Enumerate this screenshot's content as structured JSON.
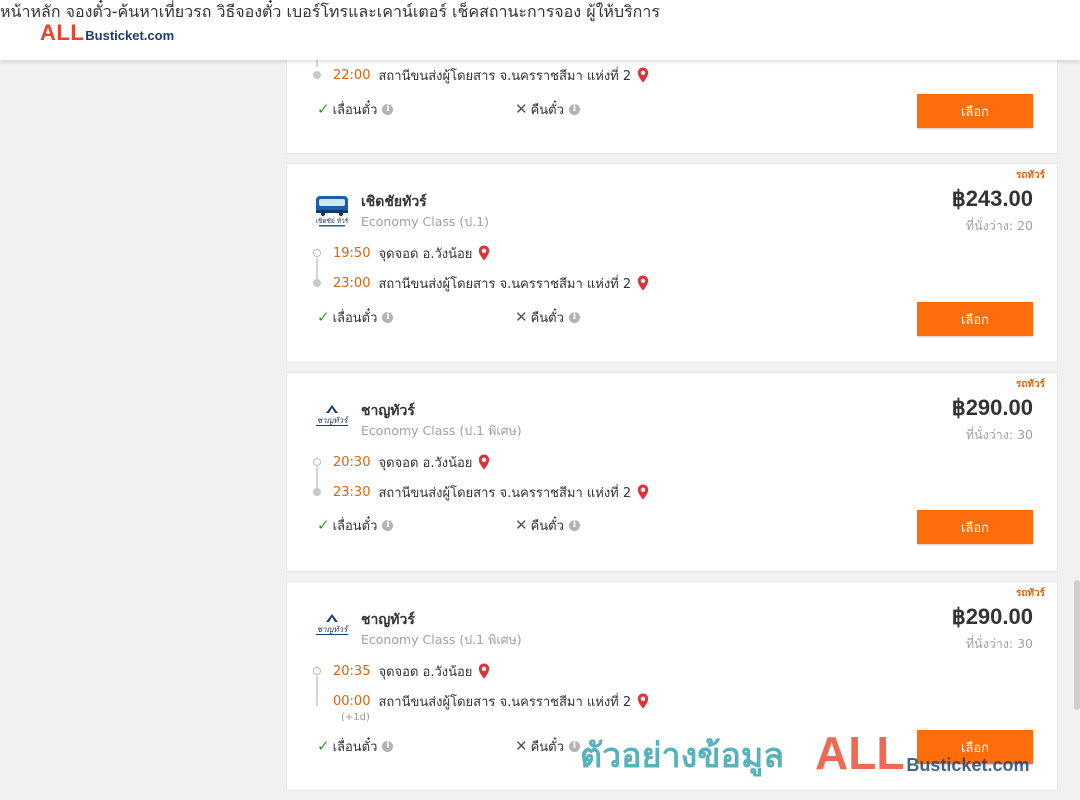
{
  "header": {
    "logo_all": "ALL",
    "logo_rest": "Busticket.com",
    "nav": [
      "หน้าหลัก",
      "จองตั๋ว-ค้นหาเที่ยวรถ",
      "วิธีจองตั๋ว",
      "เบอร์โทรและเคาน์เตอร์",
      "เช็คสถานะการจอง",
      "ผู้ให้บริการ"
    ]
  },
  "partial_card": {
    "arrive_time": "22:00",
    "arrive_place": "สถานีขนส่งผู้โดยสาร จ.นครราชสีมา แห่งที่ 2",
    "reschedule": "เลื่อนตั๋ว",
    "refund": "คืนตั๋ว",
    "select": "เลือก"
  },
  "trips": [
    {
      "tag": "รถทัวร์",
      "operator": "เชิดชัยทัวร์",
      "bus_class": "Economy Class (ป.1)",
      "price": "฿243.00",
      "seats": "ที่นั่งว่าง: 20",
      "depart_time": "19:50",
      "depart_place": "จุดจอด อ.วังน้อย",
      "arrive_time": "23:00",
      "arrive_place": "สถานีขนส่งผู้โดยสาร จ.นครราชสีมา แห่งที่ 2",
      "next_day": "",
      "reschedule": "เลื่อนตั๋ว",
      "refund": "คืนตั๋ว",
      "select": "เลือก",
      "logo_caption": "เชิดชัย ทัวร์"
    },
    {
      "tag": "รถทัวร์",
      "operator": "ชาญทัวร์",
      "bus_class": "Economy Class (ป.1 พิเศษ)",
      "price": "฿290.00",
      "seats": "ที่นั่งว่าง: 30",
      "depart_time": "20:30",
      "depart_place": "จุดจอด อ.วังน้อย",
      "arrive_time": "23:30",
      "arrive_place": "สถานีขนส่งผู้โดยสาร จ.นครราชสีมา แห่งที่ 2",
      "next_day": "",
      "reschedule": "เลื่อนตั๋ว",
      "refund": "คืนตั๋ว",
      "select": "เลือก",
      "logo_caption": "ชาญทัวร์"
    },
    {
      "tag": "รถทัวร์",
      "operator": "ชาญทัวร์",
      "bus_class": "Economy Class (ป.1 พิเศษ)",
      "price": "฿290.00",
      "seats": "ที่นั่งว่าง: 30",
      "depart_time": "20:35",
      "depart_place": "จุดจอด อ.วังน้อย",
      "arrive_time": "00:00",
      "arrive_place": "สถานีขนส่งผู้โดยสาร จ.นครราชสีมา แห่งที่ 2",
      "next_day": "(+1d)",
      "reschedule": "เลื่อนตั๋ว",
      "refund": "คืนตั๋ว",
      "select": "เลือก",
      "logo_caption": "ชาญทัวร์"
    }
  ],
  "icons": {
    "location": "map-pin-icon",
    "check": "check-icon",
    "cross": "x-icon",
    "info": "info-icon"
  },
  "colors": {
    "accent": "#fe6d0b",
    "time": "#e0620c",
    "check": "#2a9d3a",
    "pin": "#e0323a"
  },
  "watermark": {
    "text": "ตัวอย่างข้อมูล",
    "logo_all": "ALL",
    "logo_rest": "Busticket.com"
  }
}
